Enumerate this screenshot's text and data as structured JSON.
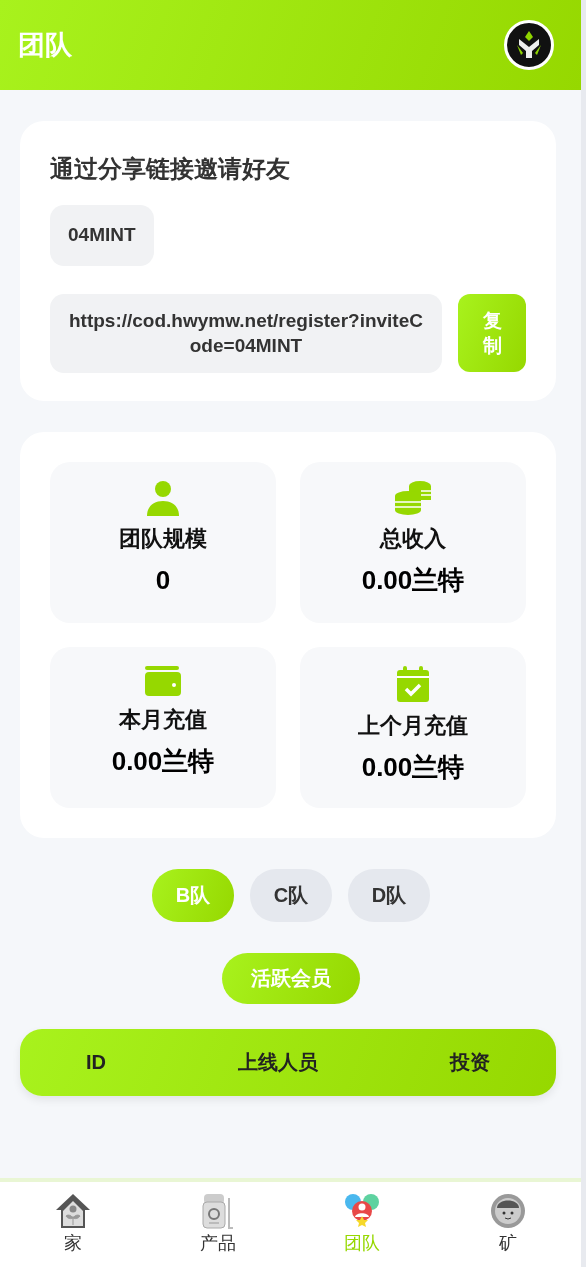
{
  "header": {
    "title": "团队"
  },
  "invite": {
    "heading": "通过分享链接邀请好友",
    "code": "04MINT",
    "link": "https://cod.hwymw.net/register?inviteCode=04MINT",
    "copy_button": "复制"
  },
  "stats": [
    {
      "kind": "person",
      "label": "团队规模",
      "value": "0"
    },
    {
      "kind": "coins",
      "label": "总收入",
      "value": "0.00兰特"
    },
    {
      "kind": "wallet",
      "label": "本月充值",
      "value": "0.00兰特"
    },
    {
      "kind": "calendar",
      "label": "上个月充值",
      "value": "0.00兰特"
    }
  ],
  "team_tabs": [
    {
      "label": "B队",
      "selected": true
    },
    {
      "label": "C队",
      "selected": false
    },
    {
      "label": "D队",
      "selected": false
    }
  ],
  "active_members_button": "活跃会员",
  "table": {
    "columns": [
      "ID",
      "上线人员",
      "投资"
    ]
  },
  "bottom_nav": [
    {
      "kind": "home",
      "label": "家",
      "selected": false
    },
    {
      "kind": "product",
      "label": "产品",
      "selected": false
    },
    {
      "kind": "team",
      "label": "团队",
      "selected": true
    },
    {
      "kind": "mine",
      "label": "矿",
      "selected": false
    }
  ]
}
